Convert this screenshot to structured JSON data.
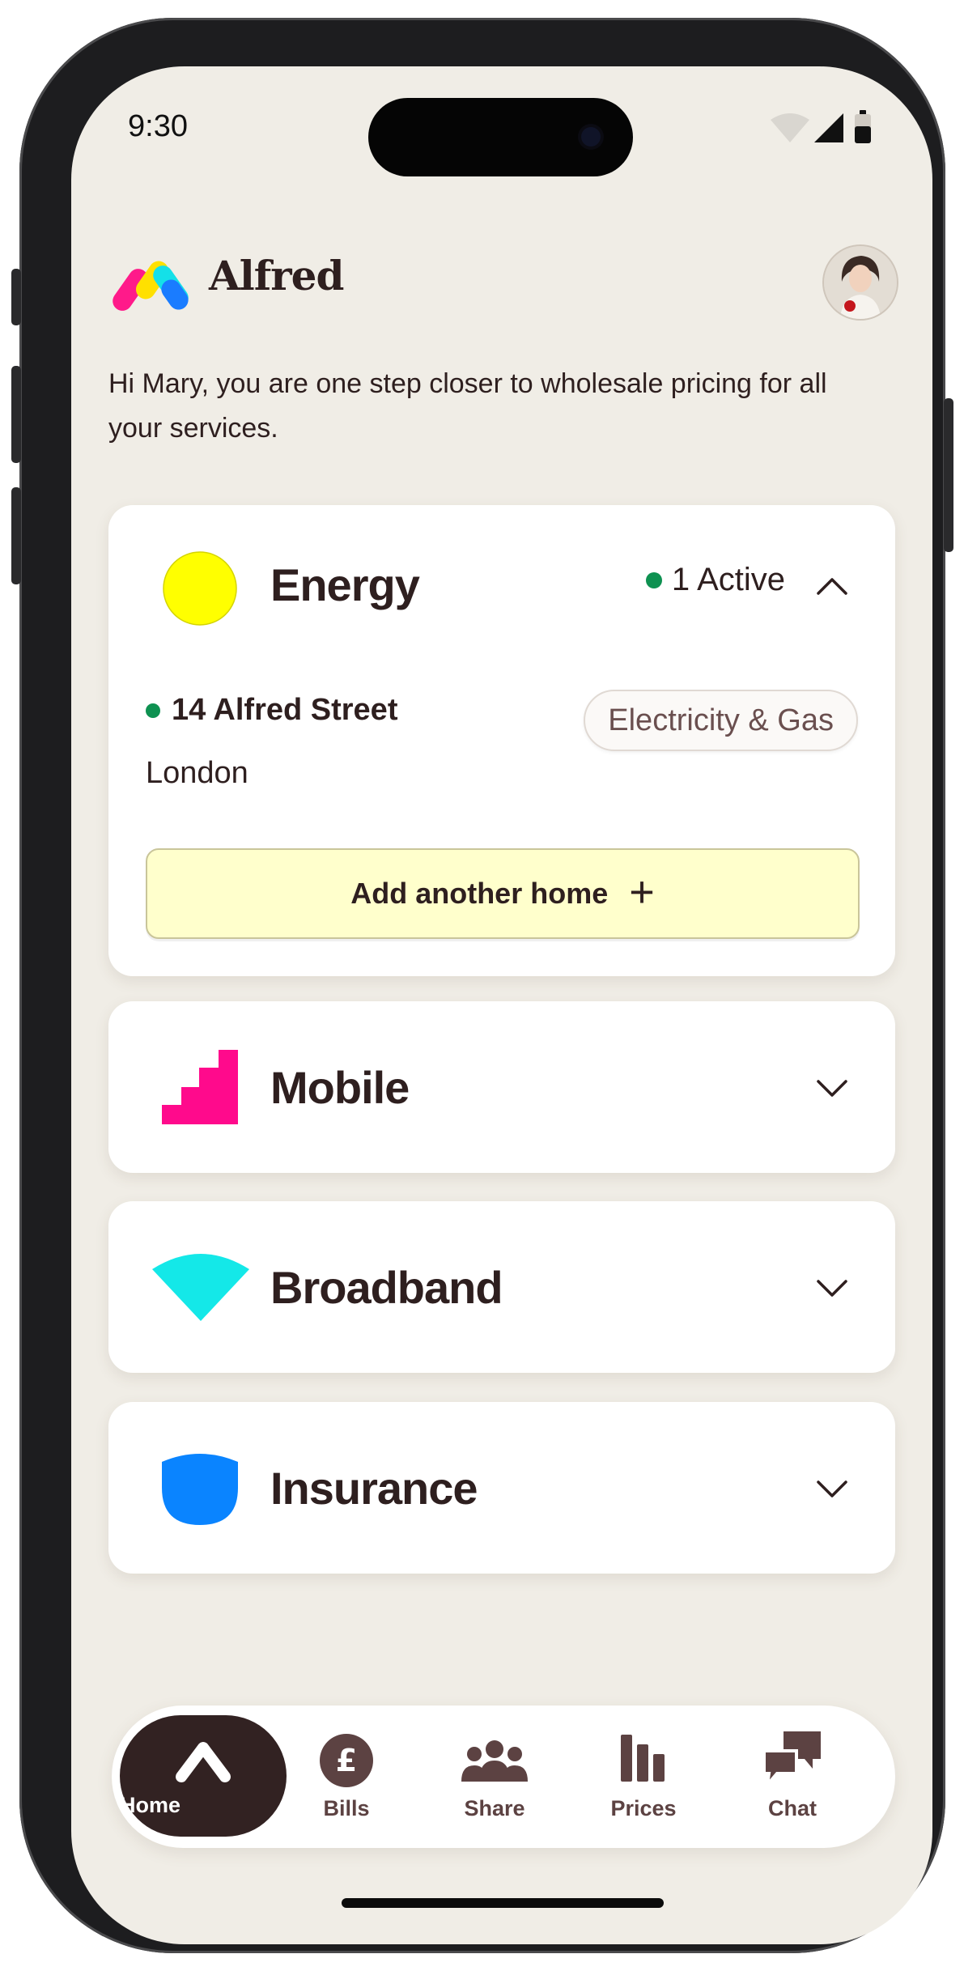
{
  "status_bar": {
    "time": "9:30"
  },
  "header": {
    "brand": "Alfred",
    "greeting": "Hi Mary, you are one step closer to wholesale pricing for all your services."
  },
  "services": {
    "energy": {
      "title": "Energy",
      "active_label": "1 Active",
      "expanded": true,
      "address": "14 Alfred Street",
      "city": "London",
      "tag": "Electricity & Gas",
      "add_button": "Add another home"
    },
    "mobile": {
      "title": "Mobile",
      "expanded": false
    },
    "broadband": {
      "title": "Broadband",
      "expanded": false
    },
    "insurance": {
      "title": "Insurance",
      "expanded": false
    }
  },
  "nav": {
    "items": [
      {
        "label": "Home",
        "icon": "home-chevron-icon",
        "active": true
      },
      {
        "label": "Bills",
        "icon": "pound-coin-icon"
      },
      {
        "label": "Share",
        "icon": "people-icon"
      },
      {
        "label": "Prices",
        "icon": "bar-chart-icon"
      },
      {
        "label": "Chat",
        "icon": "chat-bubbles-icon"
      }
    ]
  },
  "colors": {
    "background": "#f0ede6",
    "text": "#2e1f1f",
    "active_dot": "#0e9151",
    "energy": "#ffff00",
    "mobile": "#ff0a8c",
    "broadband": "#14e8e8",
    "insurance": "#0a84ff",
    "add_button": "#ffffcc",
    "nav_active": "#322222"
  }
}
